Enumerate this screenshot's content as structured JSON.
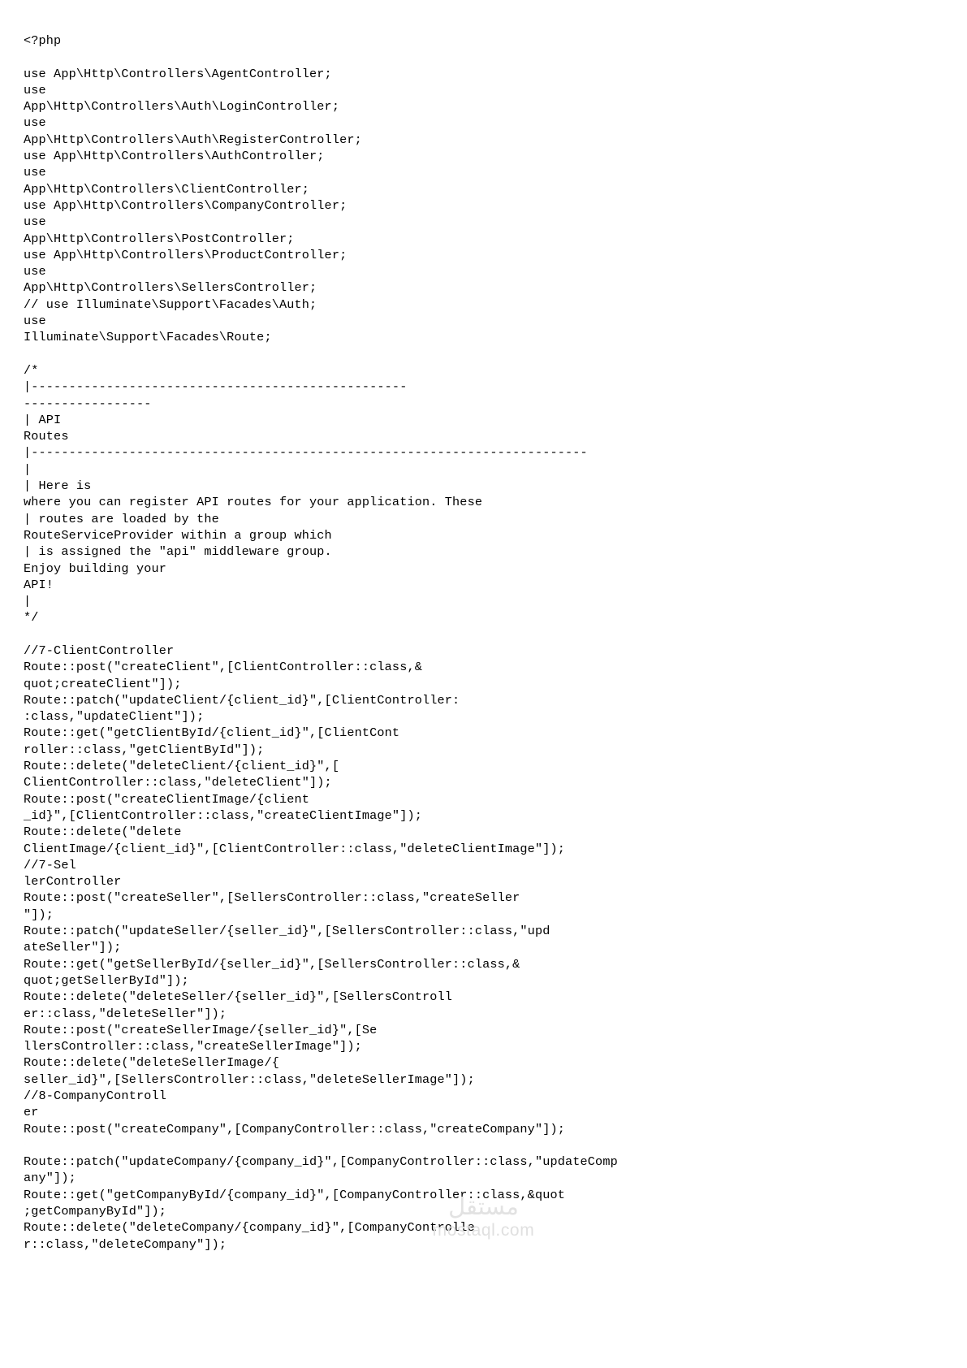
{
  "document": {
    "kind": "source-code-listing",
    "language": "php",
    "text_color": "#000000",
    "background_color": "#ffffff",
    "lines": [
      "<?php",
      "",
      "use App\\Http\\Controllers\\AgentController;",
      "use",
      "App\\Http\\Controllers\\Auth\\LoginController;",
      "use",
      "App\\Http\\Controllers\\Auth\\RegisterController;",
      "use App\\Http\\Controllers\\AuthController;",
      "use",
      "App\\Http\\Controllers\\ClientController;",
      "use App\\Http\\Controllers\\CompanyController;",
      "use",
      "App\\Http\\Controllers\\PostController;",
      "use App\\Http\\Controllers\\ProductController;",
      "use",
      "App\\Http\\Controllers\\SellersController;",
      "// use Illuminate\\Support\\Facades\\Auth;",
      "use",
      "Illuminate\\Support\\Facades\\Route;",
      "",
      "/*",
      "|--------------------------------------------------",
      "-----------------",
      "| API",
      "Routes",
      "|--------------------------------------------------------------------------",
      "|",
      "| Here is",
      "where you can register API routes for your application. These",
      "| routes are loaded by the",
      "RouteServiceProvider within a group which",
      "| is assigned the \"api\" middleware group.",
      "Enjoy building your",
      "API!",
      "|",
      "*/",
      "",
      "//7-ClientController",
      "Route::post(\"createClient\",[ClientController::class,&",
      "quot;createClient\"]);",
      "Route::patch(\"updateClient/{client_id}\",[ClientController:",
      ":class,\"updateClient\"]);",
      "Route::get(\"getClientById/{client_id}\",[ClientCont",
      "roller::class,\"getClientById\"]);",
      "Route::delete(\"deleteClient/{client_id}\",[",
      "ClientController::class,\"deleteClient\"]);",
      "Route::post(\"createClientImage/{client",
      "_id}\",[ClientController::class,\"createClientImage\"]);",
      "Route::delete(\"delete",
      "ClientImage/{client_id}\",[ClientController::class,\"deleteClientImage\"]);",
      "//7-Sel",
      "lerController",
      "Route::post(\"createSeller\",[SellersController::class,\"createSeller",
      "\"]);",
      "Route::patch(\"updateSeller/{seller_id}\",[SellersController::class,\"upd",
      "ateSeller\"]);",
      "Route::get(\"getSellerById/{seller_id}\",[SellersController::class,&",
      "quot;getSellerById\"]);",
      "Route::delete(\"deleteSeller/{seller_id}\",[SellersControll",
      "er::class,\"deleteSeller\"]);",
      "Route::post(\"createSellerImage/{seller_id}\",[Se",
      "llersController::class,\"createSellerImage\"]);",
      "Route::delete(\"deleteSellerImage/{",
      "seller_id}\",[SellersController::class,\"deleteSellerImage\"]);",
      "//8-CompanyControll",
      "er",
      "Route::post(\"createCompany\",[CompanyController::class,\"createCompany\"]);",
      "",
      "Route::patch(\"updateCompany/{company_id}\",[CompanyController::class,\"updateComp",
      "any\"]);",
      "Route::get(\"getCompanyById/{company_id}\",[CompanyController::class,&quot",
      ";getCompanyById\"]);",
      "Route::delete(\"deleteCompany/{company_id}\",[CompanyControlle",
      "r::class,\"deleteCompany\"]);"
    ]
  },
  "watermark": {
    "mark": "مستقل",
    "domain": "mostaql.com",
    "color": "#e2e2e2"
  }
}
